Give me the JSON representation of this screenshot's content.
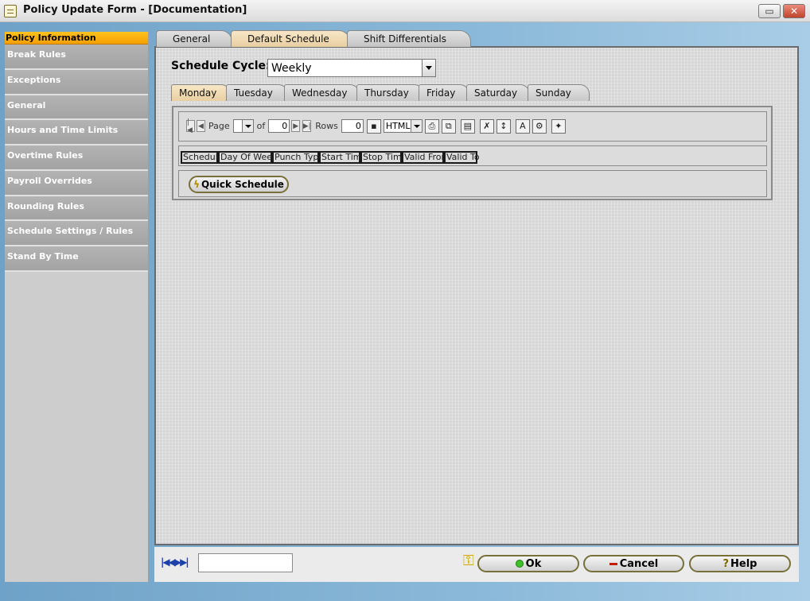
{
  "window": {
    "title": "Policy Update Form - [Documentation]",
    "minimize_glyph": "▭",
    "close_glyph": "✕"
  },
  "sidebar": {
    "items": [
      {
        "label": "Policy Information",
        "active": true
      },
      {
        "label": "Break Rules"
      },
      {
        "label": "Exceptions"
      },
      {
        "label": "General"
      },
      {
        "label": "Hours and Time Limits"
      },
      {
        "label": "Overtime Rules"
      },
      {
        "label": "Payroll Overrides"
      },
      {
        "label": "Rounding Rules"
      },
      {
        "label": "Schedule Settings / Rules"
      },
      {
        "label": "Stand By Time"
      }
    ]
  },
  "tabs": [
    {
      "label": "General"
    },
    {
      "label": "Default Schedule",
      "selected": true
    },
    {
      "label": "Shift Differentials"
    }
  ],
  "schedule_cycle": {
    "label": "Schedule Cycle:",
    "value": "Weekly"
  },
  "day_tabs": [
    {
      "label": "Monday",
      "selected": true
    },
    {
      "label": "Tuesday"
    },
    {
      "label": "Wednesday"
    },
    {
      "label": "Thursday"
    },
    {
      "label": "Friday"
    },
    {
      "label": "Saturday"
    },
    {
      "label": "Sunday"
    }
  ],
  "grid_toolbar": {
    "page_label": "Page",
    "page_value": "",
    "of_label": "of",
    "of_value": "0",
    "rows_label": "Rows",
    "rows_value": "0",
    "export_format": "HTML"
  },
  "grid_columns": [
    "Schedule",
    "Day Of Week",
    "Punch Type",
    "Start Time",
    "Stop Time",
    "Valid From",
    "Valid To"
  ],
  "quick_schedule_label": "Quick Schedule",
  "bottom_bar": {
    "nav_glyphs": "|◀◀▶▶|",
    "nav_value": "",
    "ok_label": "Ok",
    "cancel_label": "Cancel",
    "help_label": "Help"
  },
  "colors": {
    "active_sidebar": "#f5a500",
    "selected_tab": "#f0dbb4",
    "nav_blue": "#1c41a8"
  }
}
